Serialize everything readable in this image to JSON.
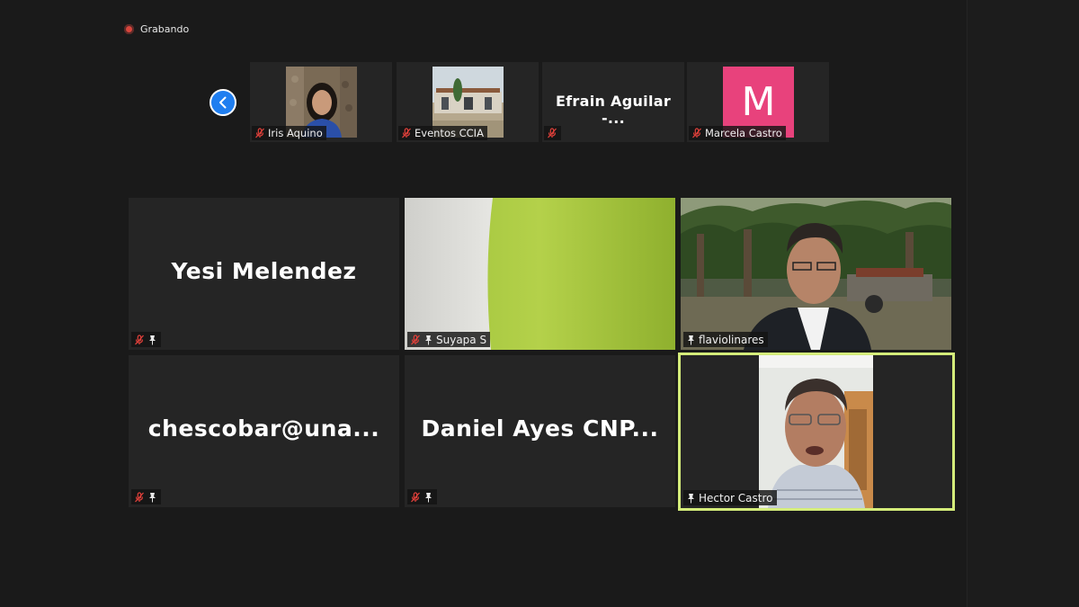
{
  "recording": {
    "label": "Grabando"
  },
  "strip": [
    {
      "name": "Iris Aquino",
      "muted": true,
      "type": "video"
    },
    {
      "name": "Eventos CCIA",
      "muted": true,
      "type": "video"
    },
    {
      "name": "Efrain Aguilar -...",
      "muted": true,
      "type": "name"
    },
    {
      "name": "Marcela Castro",
      "muted": true,
      "type": "avatar",
      "initial": "M",
      "avatar_color": "#e8427c"
    }
  ],
  "tiles": [
    {
      "name": "Yesi Melendez",
      "muted": true,
      "pinned": true,
      "type": "name"
    },
    {
      "name": "Suyapa S",
      "muted": true,
      "pinned": true,
      "type": "video"
    },
    {
      "name": "flaviolinares",
      "muted": false,
      "pinned": true,
      "type": "video"
    },
    {
      "name": "chescobar@una...",
      "muted": true,
      "pinned": true,
      "type": "name"
    },
    {
      "name": "Daniel Ayes CNP...",
      "muted": true,
      "pinned": true,
      "type": "name"
    },
    {
      "name": "Hector Castro",
      "muted": false,
      "pinned": true,
      "type": "video",
      "active": true
    }
  ],
  "colors": {
    "active_speaker": "#d4ec7a",
    "nav_button": "#1f7ef0",
    "muted_icon": "#e0403a"
  }
}
